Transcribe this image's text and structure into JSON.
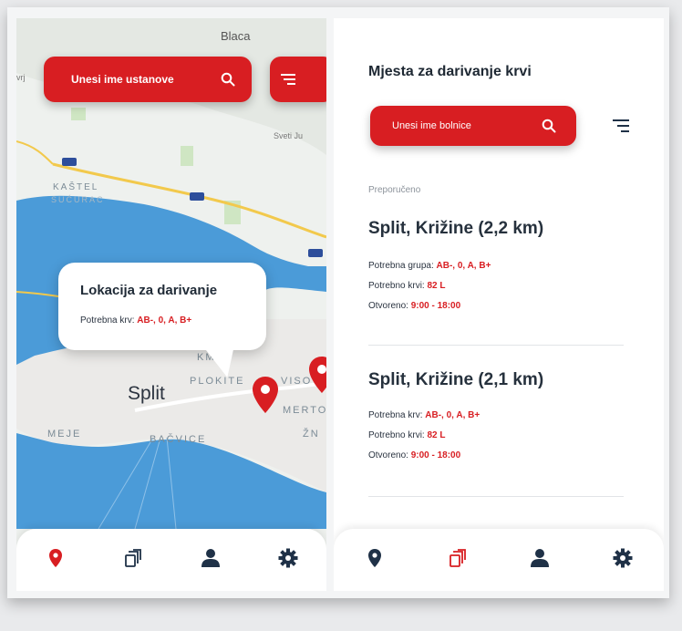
{
  "map_screen": {
    "search_placeholder": "Unesi ime ustanove",
    "map_labels": {
      "top": "Blaca",
      "left_edge": "vrj",
      "sveti": "Sveti Ju",
      "kastel": "KAŠTEL",
      "kastel_sub": "SUĆURAC",
      "kman": "KMAN",
      "plokite": "PLOKITE",
      "visoka": "VISO",
      "merten": "MERTO",
      "zn": "ŽN",
      "meje": "MEJE",
      "bacvice": "BAČVICE",
      "city": "Split"
    },
    "popup": {
      "title": "Lokacija za darivanje",
      "label": "Potrebna krv:",
      "value": "AB-, 0, A, B+"
    }
  },
  "list_screen": {
    "title": "Mjesta za darivanje krvi",
    "search_placeholder": "Unesi ime bolnice",
    "section_label": "Preporučeno",
    "cards": [
      {
        "title": "Split, Križine (2,2 km)",
        "group_label": "Potrebna grupa:",
        "group_value": "AB-, 0, A, B+",
        "blood_label": "Potrebno krvi:",
        "blood_value": "82 L",
        "open_label": "Otvoreno:",
        "open_value": "9:00 - 18:00"
      },
      {
        "title": "Split, Križine (2,1 km)",
        "group_label": "Potrebna krv:",
        "group_value": "AB-, 0, A, B+",
        "blood_label": "Potrebno krvi:",
        "blood_value": "82 L",
        "open_label": "Otvoreno:",
        "open_value": "9:00 - 18:00"
      }
    ]
  },
  "nav_icons": [
    "location-pin-icon",
    "copy-cards-icon",
    "user-icon",
    "gear-icon"
  ],
  "colors": {
    "accent": "#d81e22",
    "nav_icon": "#1f3147",
    "sea": "#4b9bd8",
    "land": "#eef1ee"
  }
}
